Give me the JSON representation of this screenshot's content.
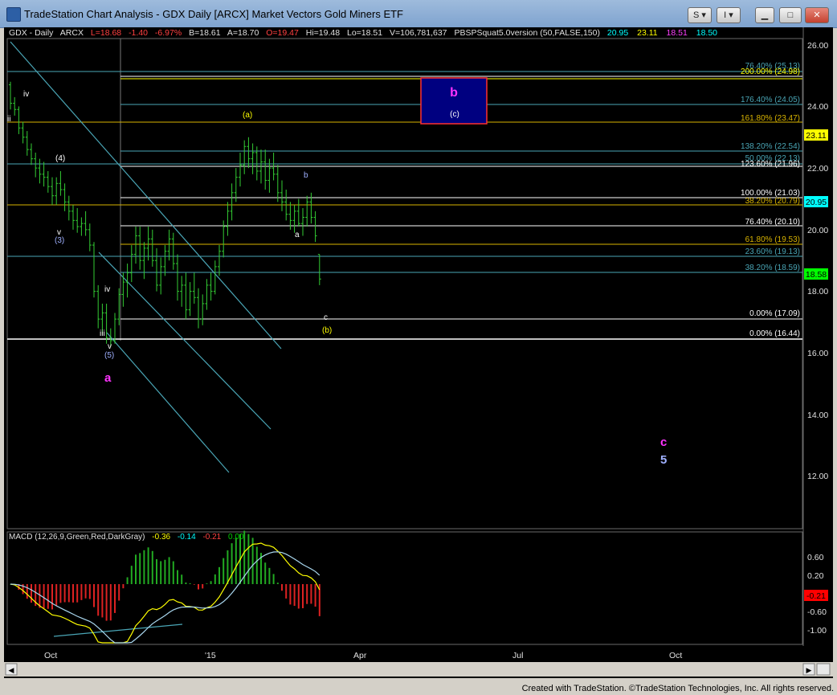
{
  "window": {
    "title": "TradeStation Chart Analysis - GDX Daily [ARCX] Market Vectors Gold Miners ETF",
    "buttons": {
      "s": "S",
      "i": "I",
      "minimize": "▁",
      "maximize": "□",
      "close": "✕"
    }
  },
  "header": {
    "symbol": "GDX - Daily",
    "exchange": "ARCX",
    "last": "L=18.68",
    "change": "-1.40",
    "pct": "-6.97%",
    "bid": "B=18.61",
    "ask": "A=18.70",
    "open": "O=19.47",
    "high": "Hi=19.48",
    "low": "Lo=18.51",
    "volume": "V=106,781,637",
    "study": "PBSPSquat5.0version (50,FALSE,150)",
    "study_values": [
      "20.95",
      "23.11",
      "18.51",
      "18.50"
    ]
  },
  "price_axis": {
    "ticks": [
      "26.00",
      "24.00",
      "22.00",
      "20.00",
      "18.00",
      "16.00",
      "14.00",
      "12.00"
    ]
  },
  "price_boxes": [
    {
      "label": "23.11",
      "color": "#ffff00"
    },
    {
      "label": "20.95",
      "color": "#00ffff"
    },
    {
      "label": "18.58",
      "color": "#00ff00"
    }
  ],
  "fib_labels": [
    {
      "text": "76.40% (25.13)",
      "color": "#4aa6b6"
    },
    {
      "text": "200.00% (24.98)",
      "color": "#ffff00"
    },
    {
      "text": "176.40% (24.05)",
      "color": "#4aa6b6"
    },
    {
      "text": "161.80% (23.47)",
      "color": "#d9b400"
    },
    {
      "text": "138.20% (22.54)",
      "color": "#4aa6b6"
    },
    {
      "text": "50.00% (22.13)",
      "color": "#4aa6b6"
    },
    {
      "text": "123.60% (21.96)",
      "color": "#ffffff"
    },
    {
      "text": "100.00% (21.03)",
      "color": "#ffffff"
    },
    {
      "text": "38.20% (20.79)",
      "color": "#d9b400"
    },
    {
      "text": "76.40% (20.10)",
      "color": "#ffffff"
    },
    {
      "text": "61.80% (19.53)",
      "color": "#d9b400"
    },
    {
      "text": "23.60% (19.13)",
      "color": "#4aa6b6"
    },
    {
      "text": "38.20% (18.59)",
      "color": "#4aa6b6"
    },
    {
      "text": "0.00% (17.09)",
      "color": "#ffffff"
    },
    {
      "text": "0.00% (16.44)",
      "color": "#ffffff"
    }
  ],
  "wave_labels": [
    {
      "text": "iv",
      "color": "#ffffff"
    },
    {
      "text": "ii",
      "color": "#ffffff"
    },
    {
      "text": "(4)",
      "color": "#ffffff"
    },
    {
      "text": "v",
      "color": "#ffffff"
    },
    {
      "text": "(3)",
      "color": "#9fb0ff"
    },
    {
      "text": "iv",
      "color": "#ffffff"
    },
    {
      "text": "iii",
      "color": "#ffffff"
    },
    {
      "text": "v",
      "color": "#ffffff"
    },
    {
      "text": "(5)",
      "color": "#9fb0ff"
    },
    {
      "text": "a",
      "color": "#ff33ff"
    },
    {
      "text": "(a)",
      "color": "#ffff00"
    },
    {
      "text": "b",
      "color": "#9fb0ff"
    },
    {
      "text": "a",
      "color": "#ffffff"
    },
    {
      "text": "c",
      "color": "#ffffff"
    },
    {
      "text": "(b)",
      "color": "#ffff00"
    },
    {
      "text": "c",
      "color": "#ff33ff"
    },
    {
      "text": "5",
      "color": "#9fb0ff"
    }
  ],
  "target_box": {
    "big": "b",
    "small": "(c)",
    "big_color": "#ff33ff",
    "small_color": "#ffffff"
  },
  "macd": {
    "label": "MACD (12,26,9,Green,Red,DarkGray)",
    "v1": "-0.36",
    "v2": "-0.14",
    "v3": "-0.21",
    "v4": "0.00",
    "ticks": [
      "0.60",
      "0.20",
      "-0.60",
      "-1.00"
    ],
    "current_box": "-0.21"
  },
  "time_axis": {
    "labels": [
      "Oct",
      "'15",
      "Apr",
      "Jul",
      "Oct"
    ]
  },
  "footer": {
    "text": "Created with TradeStation. ©TradeStation Technologies, Inc. All rights reserved."
  },
  "chart_data": {
    "type": "bar",
    "symbol": "GDX",
    "interval": "Daily",
    "ohlc_approx": [
      [
        25.0,
        25.1,
        24.2,
        24.4
      ],
      [
        24.4,
        24.6,
        24.0,
        24.2
      ],
      [
        24.2,
        24.3,
        23.4,
        23.6
      ],
      [
        23.6,
        23.8,
        23.1,
        23.3
      ],
      [
        23.3,
        23.5,
        22.7,
        22.9
      ],
      [
        22.9,
        23.1,
        22.4,
        22.6
      ],
      [
        22.6,
        22.8,
        22.0,
        22.3
      ],
      [
        22.3,
        22.6,
        21.8,
        22.1
      ],
      [
        22.1,
        22.5,
        21.7,
        22.0
      ],
      [
        22.0,
        22.2,
        21.5,
        21.7
      ],
      [
        21.7,
        22.0,
        21.1,
        21.4
      ],
      [
        21.4,
        22.0,
        21.1,
        21.8
      ],
      [
        21.8,
        22.2,
        21.4,
        21.6
      ],
      [
        21.6,
        21.8,
        20.9,
        21.2
      ],
      [
        21.2,
        21.4,
        20.6,
        20.9
      ],
      [
        20.9,
        21.1,
        20.3,
        20.6
      ],
      [
        20.6,
        21.0,
        20.2,
        20.4
      ],
      [
        20.4,
        20.7,
        20.1,
        20.5
      ],
      [
        20.5,
        20.9,
        20.1,
        20.3
      ],
      [
        20.3,
        20.5,
        19.6,
        19.8
      ],
      [
        19.8,
        19.9,
        18.1,
        18.3
      ],
      [
        18.3,
        18.5,
        17.1,
        17.4
      ],
      [
        17.4,
        17.9,
        16.9,
        17.6
      ],
      [
        17.6,
        17.9,
        16.6,
        16.8
      ],
      [
        16.8,
        17.1,
        16.5,
        16.7
      ],
      [
        16.7,
        17.6,
        16.6,
        17.4
      ],
      [
        17.4,
        18.4,
        17.2,
        18.2
      ],
      [
        18.2,
        18.9,
        17.8,
        18.6
      ],
      [
        18.6,
        19.2,
        18.1,
        18.9
      ],
      [
        18.9,
        19.8,
        18.6,
        19.5
      ],
      [
        19.5,
        20.4,
        19.2,
        20.1
      ],
      [
        20.1,
        20.4,
        19.0,
        19.3
      ],
      [
        19.3,
        19.9,
        18.7,
        19.7
      ],
      [
        19.7,
        20.4,
        19.3,
        20.0
      ],
      [
        20.0,
        20.3,
        19.1,
        19.3
      ],
      [
        19.3,
        19.7,
        18.3,
        18.5
      ],
      [
        18.5,
        19.4,
        18.2,
        19.1
      ],
      [
        19.1,
        19.8,
        18.8,
        19.6
      ],
      [
        19.6,
        20.3,
        19.3,
        20.0
      ],
      [
        20.0,
        20.2,
        19.0,
        19.2
      ],
      [
        19.2,
        19.5,
        18.0,
        18.3
      ],
      [
        18.3,
        18.8,
        17.8,
        18.5
      ],
      [
        18.5,
        18.9,
        17.4,
        17.7
      ],
      [
        17.7,
        18.6,
        17.5,
        18.3
      ],
      [
        18.3,
        18.9,
        17.9,
        18.1
      ],
      [
        18.1,
        18.4,
        17.1,
        17.4
      ],
      [
        17.4,
        18.2,
        17.2,
        17.9
      ],
      [
        17.9,
        18.7,
        17.7,
        18.5
      ],
      [
        18.5,
        18.9,
        18.0,
        18.3
      ],
      [
        18.3,
        19.3,
        18.2,
        19.1
      ],
      [
        19.1,
        19.8,
        18.8,
        19.6
      ],
      [
        19.6,
        20.6,
        19.4,
        20.4
      ],
      [
        20.4,
        21.2,
        20.1,
        20.9
      ],
      [
        20.9,
        21.8,
        20.6,
        21.5
      ],
      [
        21.5,
        22.3,
        21.2,
        22.0
      ],
      [
        22.0,
        22.8,
        21.7,
        22.4
      ],
      [
        22.4,
        23.2,
        22.1,
        23.0
      ],
      [
        23.0,
        23.3,
        22.3,
        22.6
      ],
      [
        22.6,
        23.1,
        22.1,
        22.8
      ],
      [
        22.8,
        23.0,
        21.9,
        22.2
      ],
      [
        22.2,
        22.9,
        21.8,
        22.5
      ],
      [
        22.5,
        22.9,
        21.6,
        21.9
      ],
      [
        21.9,
        22.6,
        21.5,
        22.3
      ],
      [
        22.3,
        22.8,
        21.9,
        22.1
      ],
      [
        22.1,
        22.4,
        21.2,
        21.5
      ],
      [
        21.5,
        21.9,
        20.9,
        21.2
      ],
      [
        21.2,
        21.6,
        20.6,
        20.8
      ],
      [
        20.8,
        21.2,
        20.3,
        20.6
      ],
      [
        20.6,
        21.1,
        20.2,
        20.9
      ],
      [
        20.9,
        21.3,
        20.4,
        20.5
      ],
      [
        20.5,
        21.0,
        20.1,
        20.7
      ],
      [
        20.7,
        21.4,
        20.4,
        21.2
      ],
      [
        21.2,
        21.5,
        20.5,
        20.7
      ],
      [
        20.7,
        20.9,
        19.9,
        20.1
      ],
      [
        19.5,
        19.5,
        18.5,
        18.7
      ]
    ],
    "ylim": [
      10.6,
      26.5
    ]
  }
}
